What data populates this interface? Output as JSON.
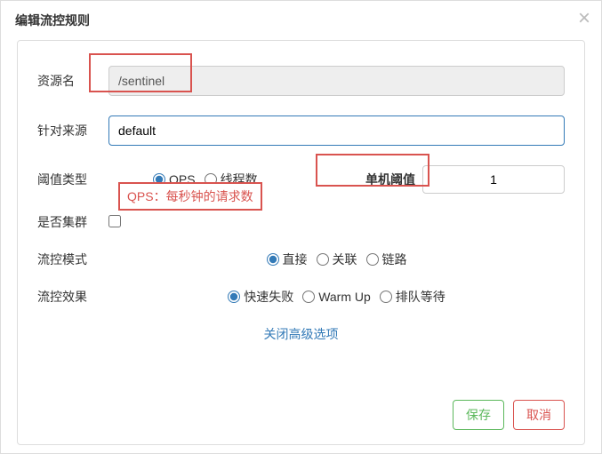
{
  "header": {
    "title": "编辑流控规则"
  },
  "form": {
    "resourceName": {
      "label": "资源名",
      "value": "/sentinel"
    },
    "source": {
      "label": "针对来源",
      "value": "default"
    },
    "thresholdType": {
      "label": "阈值类型",
      "options": {
        "qps": "QPS",
        "threads": "线程数"
      }
    },
    "threshold": {
      "label": "单机阈值",
      "value": "1"
    },
    "cluster": {
      "label": "是否集群"
    },
    "mode": {
      "label": "流控模式",
      "options": {
        "direct": "直接",
        "relation": "关联",
        "chain": "链路"
      }
    },
    "effect": {
      "label": "流控效果",
      "options": {
        "fail": "快速失败",
        "warmup": "Warm Up",
        "queue": "排队等待"
      }
    }
  },
  "annotation": {
    "qpsNote": "QPS：每秒钟的请求数"
  },
  "advancedLink": "关闭高级选项",
  "buttons": {
    "save": "保存",
    "cancel": "取消"
  }
}
